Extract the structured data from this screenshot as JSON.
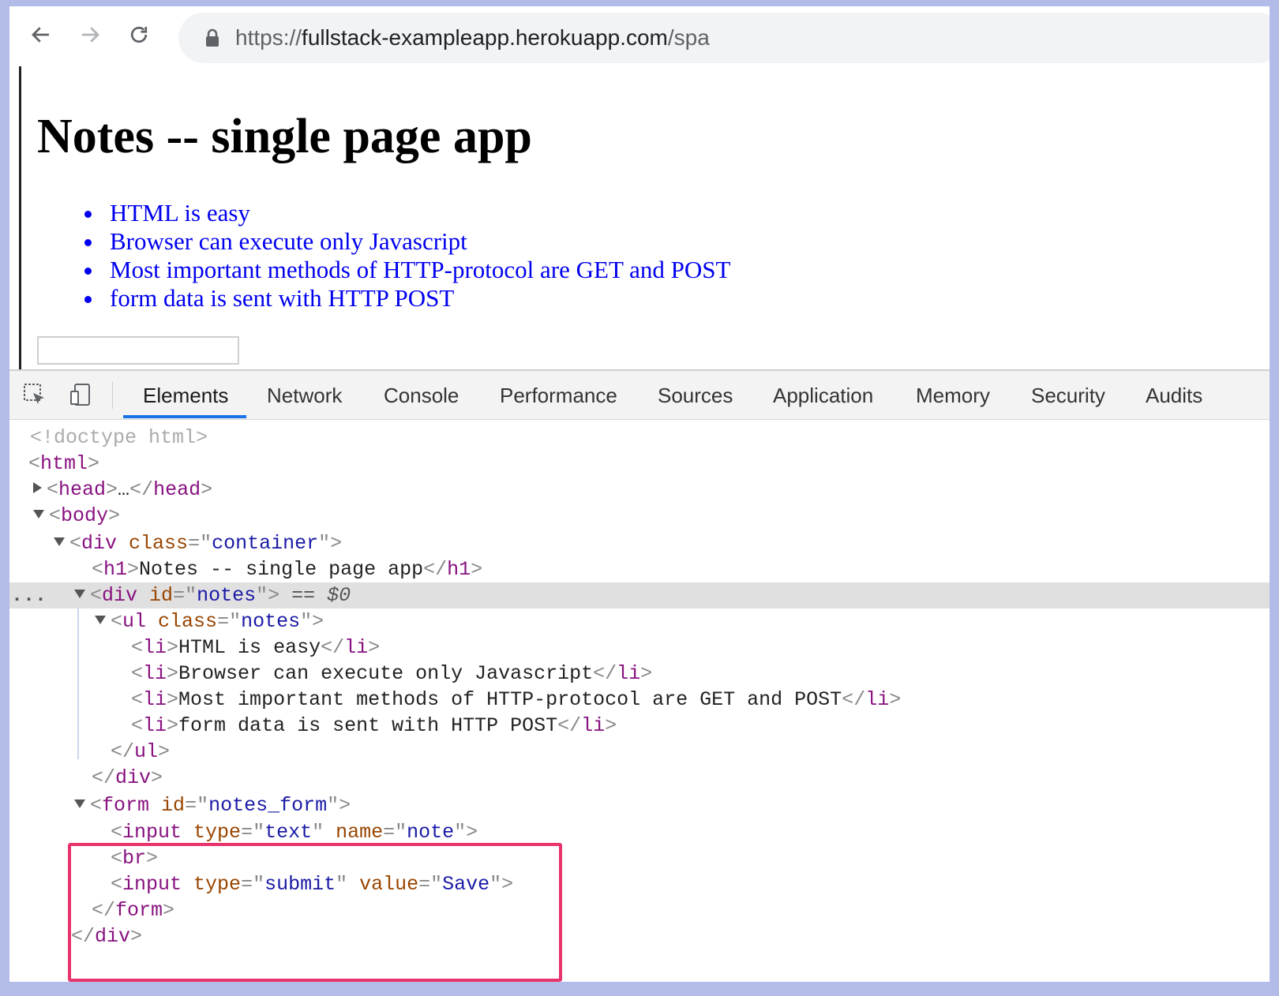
{
  "browser": {
    "url_scheme": "https://",
    "url_host": "fullstack-exampleapp.herokuapp.com",
    "url_path": "/spa"
  },
  "page": {
    "title": "Notes -- single page app",
    "notes": [
      "HTML is easy",
      "Browser can execute only Javascript",
      "Most important methods of HTTP-protocol are GET and POST",
      "form data is sent with HTTP POST"
    ],
    "note_input_value": ""
  },
  "devtools": {
    "tabs": [
      "Elements",
      "Network",
      "Console",
      "Performance",
      "Sources",
      "Application",
      "Memory",
      "Security",
      "Audits"
    ],
    "active_tab": "Elements",
    "accent_color": "#1a73e8",
    "highlight_color": "#e8336b",
    "dom": {
      "doctype": "<!doctype html>",
      "html": "html",
      "head": "head",
      "head_ellipsis": "…",
      "body": "body",
      "div": "div",
      "attr_class": "class",
      "attr_id": "id",
      "container_value": "container",
      "h1": "h1",
      "h1_text": "Notes -- single page app",
      "notes_div_value": "notes",
      "selected_marker": " == ",
      "selected_var": "$0",
      "ul": "ul",
      "ul_class_value": "notes",
      "li": "li",
      "li_texts": [
        "HTML is easy",
        "Browser can execute only Javascript",
        "Most important methods of HTTP-protocol are GET and POST",
        "form data is sent with HTTP POST"
      ],
      "form": "form",
      "form_id_value": "notes_form",
      "input": "input",
      "attr_type": "type",
      "attr_name": "name",
      "attr_value": "value",
      "type_text": "text",
      "name_note": "note",
      "br": "br",
      "type_submit": "submit",
      "value_save": "Save",
      "row_ellipsis": "..."
    }
  }
}
